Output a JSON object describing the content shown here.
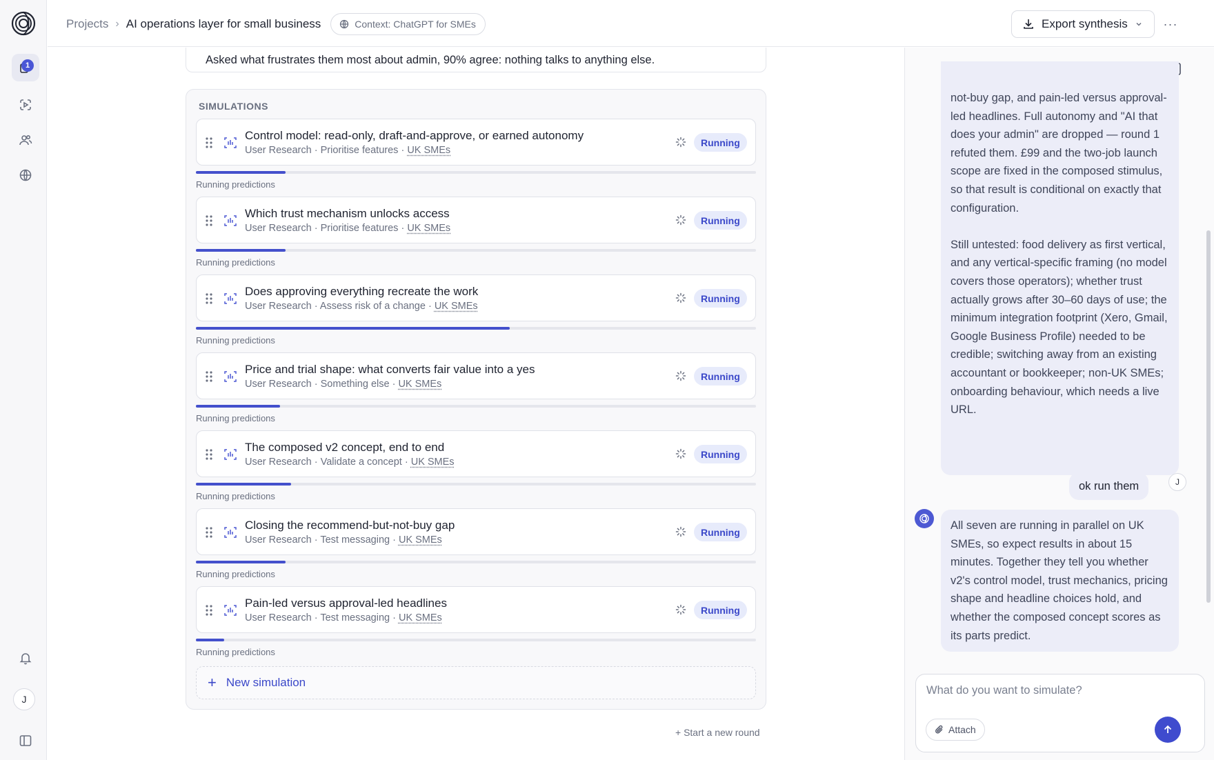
{
  "rail": {
    "notifications_badge": "1",
    "avatar_initial": "J"
  },
  "header": {
    "breadcrumb_root": "Projects",
    "breadcrumb_sep": "›",
    "title": "AI operations layer for small business",
    "context": "Context: ChatGPT for SMEs",
    "export_label": "Export synthesis",
    "more_label": "···"
  },
  "summary": {
    "text": "Asked what frustrates them most about admin, 90% agree: nothing talks to anything else."
  },
  "simulations": {
    "heading": "SIMULATIONS",
    "items": [
      {
        "title": "Control model: read-only, draft-and-approve, or earned autonomy",
        "category": "User Research",
        "type": "Prioritise features",
        "audience": "UK SMEs",
        "status": "Running",
        "progress_label": "Running predictions",
        "progress": 0.16
      },
      {
        "title": "Which trust mechanism unlocks access",
        "category": "User Research",
        "type": "Prioritise features",
        "audience": "UK SMEs",
        "status": "Running",
        "progress_label": "Running predictions",
        "progress": 0.16
      },
      {
        "title": "Does approving everything recreate the work",
        "category": "User Research",
        "type": "Assess risk of a change",
        "audience": "UK SMEs",
        "status": "Running",
        "progress_label": "Running predictions",
        "progress": 0.56
      },
      {
        "title": "Price and trial shape: what converts fair value into a yes",
        "category": "User Research",
        "type": "Something else",
        "audience": "UK SMEs",
        "status": "Running",
        "progress_label": "Running predictions",
        "progress": 0.15
      },
      {
        "title": "The composed v2 concept, end to end",
        "category": "User Research",
        "type": "Validate a concept",
        "audience": "UK SMEs",
        "status": "Running",
        "progress_label": "Running predictions",
        "progress": 0.17
      },
      {
        "title": "Closing the recommend-but-not-buy gap",
        "category": "User Research",
        "type": "Test messaging",
        "audience": "UK SMEs",
        "status": "Running",
        "progress_label": "Running predictions",
        "progress": 0.16
      },
      {
        "title": "Pain-led versus approval-led headlines",
        "category": "User Research",
        "type": "Test messaging",
        "audience": "UK SMEs",
        "status": "Running",
        "progress_label": "Running predictions",
        "progress": 0.05
      }
    ],
    "new_label": "New simulation",
    "new_round_label": "+ Start a new round"
  },
  "chat": {
    "assistant_message_1": "not-buy gap, and pain-led versus approval-led headlines. Full autonomy and \"AI that does your admin\" are dropped — round 1 refuted them. £99 and the two-job launch scope are fixed in the composed stimulus, so that result is conditional on exactly that configuration.\n\nStill untested: food delivery as first vertical, and any vertical-specific framing (no model covers those operators); whether trust actually grows after 30–60 days of use; the minimum integration footprint (Xero, Gmail, Google Business Profile) needed to be credible; switching away from an existing accountant or bookkeeper; non-UK SMEs; onboarding behaviour, which needs a live URL.",
    "user_message": "ok run them",
    "user_initial": "J",
    "assistant_message_2": "All seven are running in parallel on UK SMEs, so expect results in about 15 minutes. Together they tell you whether v2's control model, trust mechanics, pricing shape and headline choices hold, and whether the composed concept scores as its parts predict.",
    "composer_placeholder": "What do you want to simulate?",
    "attach_label": "Attach"
  },
  "colors": {
    "accent": "#4450cc",
    "badge_bg": "#e7ebfb",
    "bubble_bg": "#ecedf8"
  }
}
